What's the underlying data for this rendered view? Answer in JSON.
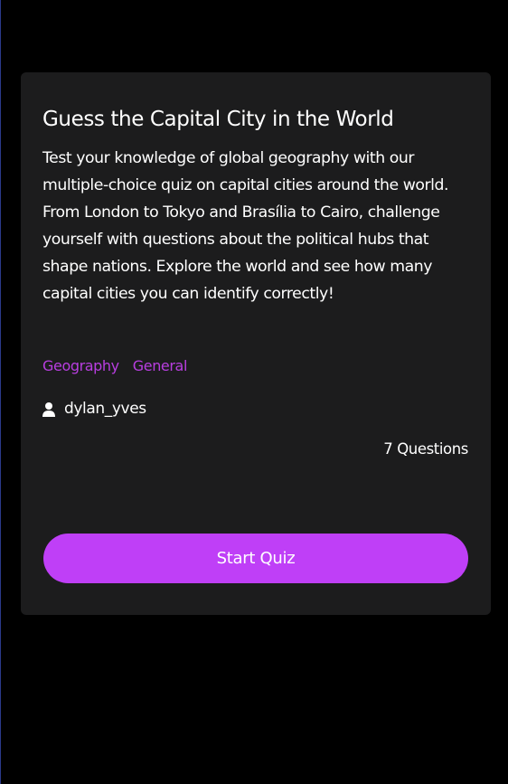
{
  "quiz": {
    "title": "Guess the Capital City in the World",
    "description": "Test your knowledge of global geography with our multiple-choice quiz on capital cities around the world. From London to Tokyo and Brasília to Cairo, challenge yourself with questions about the political hubs that shape nations. Explore the world and see how many capital cities you can identify correctly!",
    "tags": [
      "Geography",
      "General"
    ],
    "author": "dylan_yves",
    "author_icon": "user-icon",
    "question_count": "7 Questions",
    "start_label": "Start Quiz"
  },
  "colors": {
    "background": "#000000",
    "card": "#1c1c1d",
    "accent": "#bf3ff7",
    "tag": "#b83ee0",
    "text": "#ffffff"
  }
}
